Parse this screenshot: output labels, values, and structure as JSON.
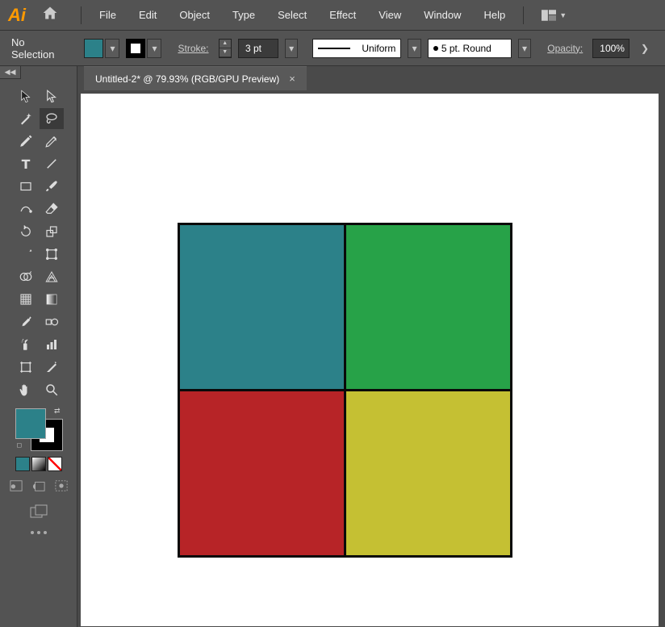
{
  "menubar": {
    "items": [
      "File",
      "Edit",
      "Object",
      "Type",
      "Select",
      "Effect",
      "View",
      "Window",
      "Help"
    ]
  },
  "control": {
    "selection": "No Selection",
    "stroke_label": "Stroke:",
    "stroke_value": "3 pt",
    "profile_label": "Uniform",
    "brush_label": "5 pt. Round",
    "opacity_label": "Opacity:",
    "opacity_value": "100%",
    "fill_color": "#2c8189",
    "stroke_color": "#000000"
  },
  "tab": {
    "title": "Untitled-2* @ 79.93% (RGB/GPU Preview)"
  },
  "canvas": {
    "squares": {
      "top_left": "#2c8189",
      "top_right": "#27a248",
      "bottom_left": "#b72427",
      "bottom_right": "#c5c033"
    }
  },
  "colors": {
    "fill": "#2c8189",
    "stroke": "#000000"
  }
}
